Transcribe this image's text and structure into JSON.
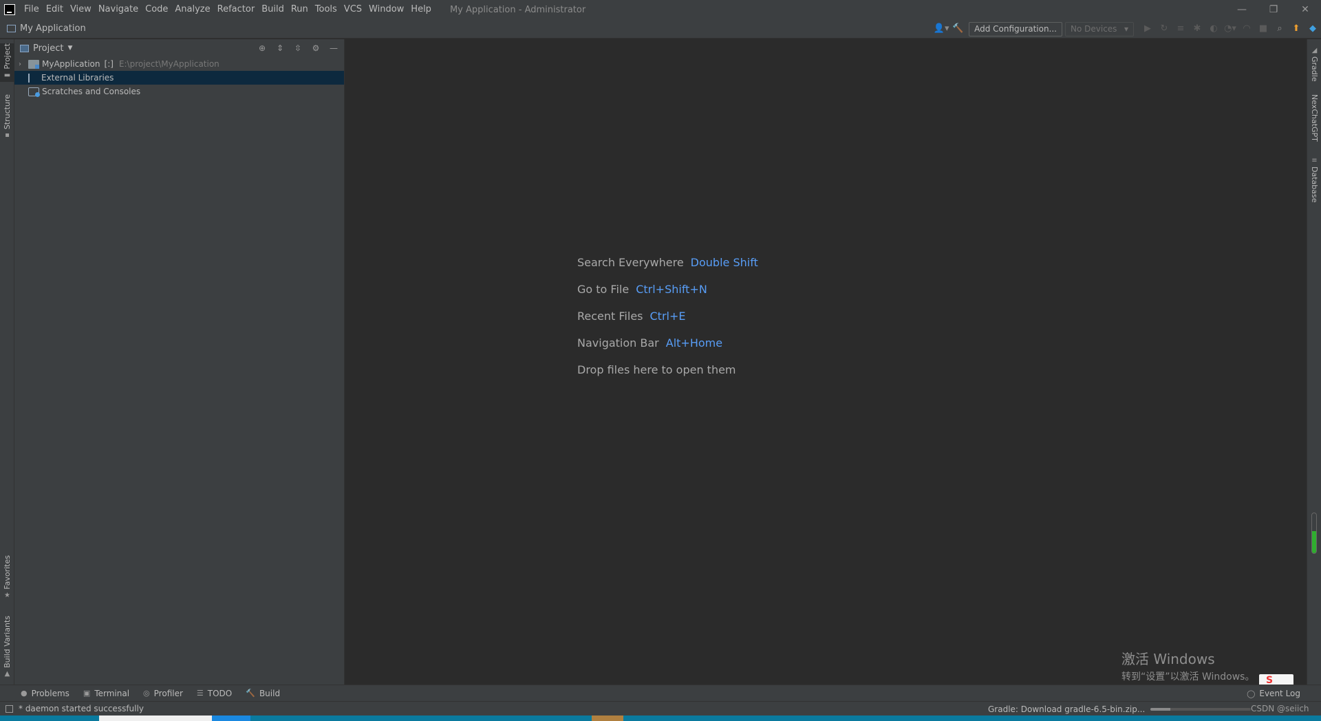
{
  "titlebar": {
    "menu": [
      "File",
      "Edit",
      "View",
      "Navigate",
      "Code",
      "Analyze",
      "Refactor",
      "Build",
      "Run",
      "Tools",
      "VCS",
      "Window",
      "Help"
    ],
    "window_title": "My Application - Administrator",
    "controls": {
      "minimize": "—",
      "restore": "❐",
      "close": "✕"
    }
  },
  "navbar": {
    "breadcrumb": "My Application",
    "add_configuration": "Add Configuration...",
    "devices": "No Devices"
  },
  "left_strip": {
    "tabs": [
      "Project",
      "Structure",
      "Favorites",
      "Build Variants"
    ]
  },
  "project_panel": {
    "title": "Project",
    "tree": [
      {
        "label": "MyApplication",
        "bracket": "[:]",
        "path": "E:\\project\\MyApplication"
      },
      {
        "label": "External Libraries"
      },
      {
        "label": "Scratches and Consoles"
      }
    ]
  },
  "editor": {
    "hints": [
      {
        "label": "Search Everywhere",
        "key": "Double Shift"
      },
      {
        "label": "Go to File",
        "key": "Ctrl+Shift+N"
      },
      {
        "label": "Recent Files",
        "key": "Ctrl+E"
      },
      {
        "label": "Navigation Bar",
        "key": "Alt+Home"
      },
      {
        "label": "Drop files here to open them",
        "key": ""
      }
    ]
  },
  "watermark": {
    "title": "激活 Windows",
    "subtitle": "转到“设置”以激活 Windows。"
  },
  "right_strip": {
    "tabs": [
      "Gradle",
      "NexChatGPT",
      "Database"
    ],
    "memory_fill": 0.55
  },
  "bottom_tabs": {
    "tabs": [
      "Problems",
      "Terminal",
      "Profiler",
      "TODO",
      "Build"
    ],
    "event_log": "Event Log"
  },
  "statusbar": {
    "message": "* daemon started successfully",
    "task": "Gradle: Download gradle-6.5-bin.zip...",
    "progress": 0.2,
    "csdn": "CSDN @seiich"
  },
  "colors": {
    "accent": "#589df6",
    "selection": "#0d293e",
    "background": "#2b2b2b",
    "panel": "#3c3f41"
  }
}
